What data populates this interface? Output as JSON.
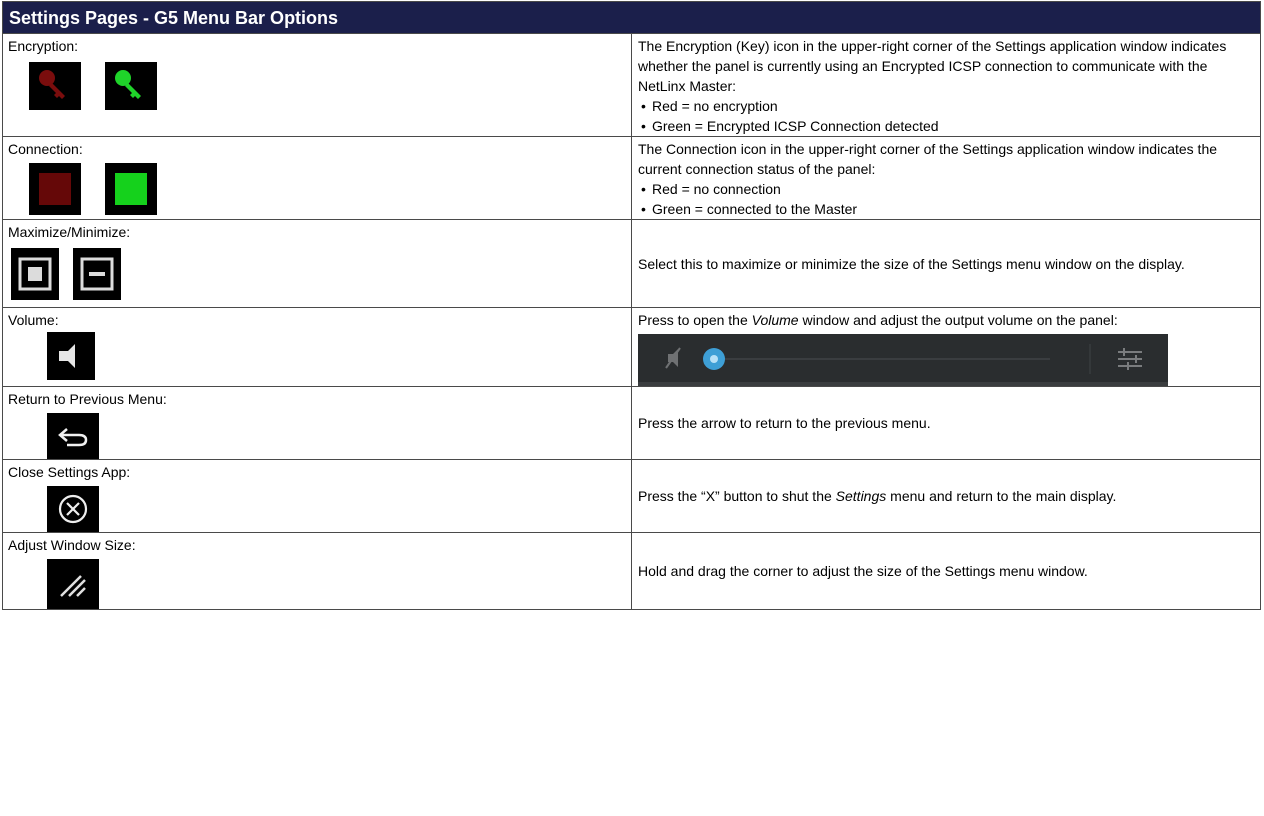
{
  "title": "Settings Pages - G5 Menu Bar Options",
  "rows": [
    {
      "label": "Encryption:",
      "icons": [
        "key-icon-red",
        "key-icon-green"
      ],
      "desc": "The Encryption (Key) icon in the upper-right corner of the Settings application window indicates whether the panel is currently using an Encrypted ICSP connection to communicate with the NetLinx Master:",
      "bullets": [
        "Red = no encryption",
        "Green = Encrypted ICSP Connection detected"
      ]
    },
    {
      "label": "Connection:",
      "icons": [
        "square-icon-red",
        "square-icon-green"
      ],
      "desc": "The Connection icon in the upper-right corner of the Settings application window indicates the current connection status of the panel:",
      "bullets": [
        "Red = no connection",
        "Green = connected to the Master"
      ]
    },
    {
      "label": "Maximize/Minimize:",
      "icons": [
        "maximize-icon",
        "minimize-icon"
      ],
      "desc": "Select this to maximize or minimize the size of the Settings menu window on the display."
    },
    {
      "label": "Volume:",
      "icons": [
        "speaker-icon"
      ],
      "desc_pre": "Press to open the ",
      "desc_em": "Volume",
      "desc_post": " window and adjust the output volume on the panel:"
    },
    {
      "label": "Return to Previous Menu:",
      "icons": [
        "return-arrow-icon"
      ],
      "desc": "Press the arrow to return to the previous menu."
    },
    {
      "label": "Close Settings App:",
      "icons": [
        "close-circle-icon"
      ],
      "desc_pre": "Press the “X” button to shut the ",
      "desc_em": "Settings",
      "desc_post": " menu and return to the main display."
    },
    {
      "label": "Adjust Window Size:",
      "icons": [
        "resize-handle-icon"
      ],
      "desc": "Hold and drag the corner to adjust the size of the Settings menu window."
    }
  ],
  "colors": {
    "header_bg": "#1b1f4b",
    "red_icon": "#6b0a0a",
    "green_icon": "#19d21b"
  }
}
